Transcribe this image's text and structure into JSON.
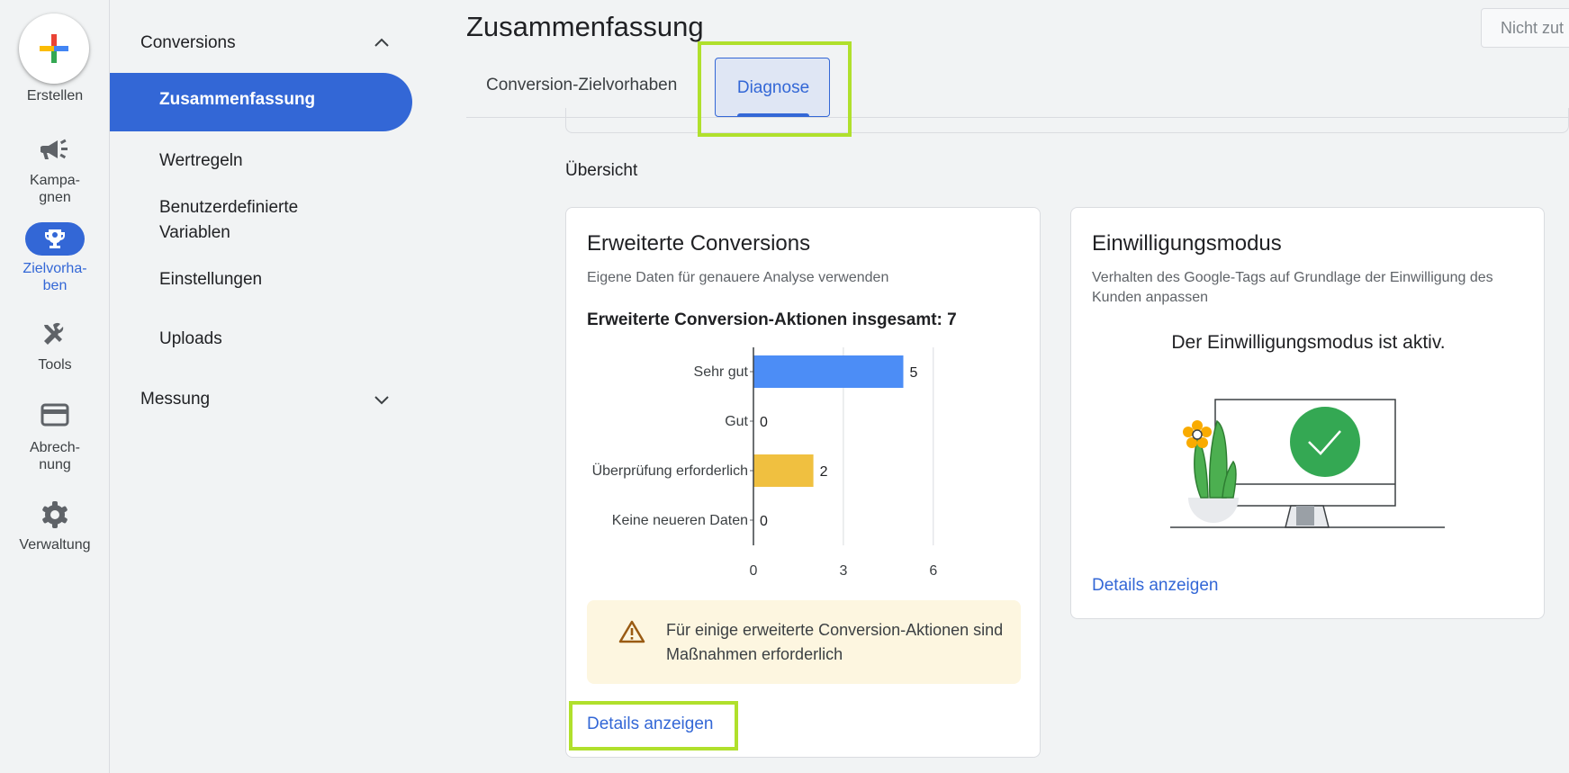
{
  "rail": {
    "create_label": "Erstellen",
    "items": [
      {
        "label": "Kampa-\ngnen",
        "icon": "megaphone-icon"
      },
      {
        "label": "Zielvorha-\nben",
        "icon": "trophy-icon"
      },
      {
        "label": "Tools",
        "icon": "tools-icon"
      },
      {
        "label": "Abrech-\nnung",
        "icon": "credit-card-icon"
      },
      {
        "label": "Verwaltung",
        "icon": "gear-icon"
      }
    ]
  },
  "subnav": {
    "conversions_header": "Conversions",
    "items": [
      "Zusammenfassung",
      "Wertregeln",
      "Benutzerdefinierte Variablen",
      "Einstellungen",
      "Uploads"
    ],
    "measurement_header": "Messung"
  },
  "header": {
    "title": "Zusammenfassung",
    "status_button": "Nicht zut"
  },
  "tabs": [
    "Conversion-Zielvorhaben",
    "Diagnose"
  ],
  "overview": {
    "title": "Übersicht"
  },
  "enhanced_card": {
    "title": "Erweiterte Conversions",
    "subtitle": "Eigene Daten für genauere Analyse verwenden",
    "total": "Erweiterte Conversion-Aktionen insgesamt: 7",
    "warning": "Für einige erweiterte Conversion-Aktionen sind Maßnahmen erforderlich",
    "link": "Details anzeigen"
  },
  "consent_card": {
    "title": "Einwilligungsmodus",
    "subtitle": "Verhalten des Google-Tags auf Grundlage der Einwilligung des Kunden anpassen",
    "status": "Der Einwilligungsmodus ist aktiv.",
    "link": "Details anzeigen"
  },
  "colors": {
    "accent": "#3367d6",
    "bar_good": "#4c8df6",
    "bar_review": "#f0c040",
    "highlight": "#b0e02c"
  },
  "chart_data": {
    "type": "bar",
    "orientation": "horizontal",
    "categories": [
      "Sehr gut",
      "Gut",
      "Überprüfung erforderlich",
      "Keine neueren Daten"
    ],
    "values": [
      5,
      0,
      2,
      0
    ],
    "bar_colors": [
      "#4c8df6",
      "#4c8df6",
      "#f0c040",
      "#4c8df6"
    ],
    "xticks": [
      0,
      3,
      6
    ],
    "xlim": [
      0,
      6
    ],
    "grid": true
  }
}
